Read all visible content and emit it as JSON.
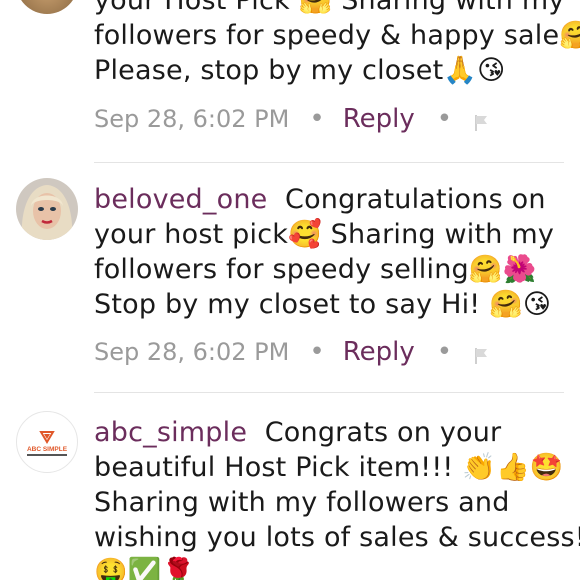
{
  "comments": [
    {
      "username": "",
      "lines": [
        "your Host Pick 🤗 Sharing with my",
        "followers for speedy & happy sale🤗",
        "Please, stop by my closet🙏😘"
      ],
      "timestamp": "Sep 28, 6:02 PM",
      "reply_label": "Reply"
    },
    {
      "username": "beloved_one",
      "lines": [
        "Congratulations on",
        "your host pick🥰 Sharing with my",
        "followers for speedy selling🤗🌺",
        "Stop by my closet to say Hi! 🤗😘"
      ],
      "timestamp": "Sep 28, 6:02 PM",
      "reply_label": "Reply"
    },
    {
      "username": "abc_simple",
      "avatar_text": "ABC SIMPLE",
      "lines": [
        "Congrats on your",
        "beautiful Host Pick item!!! 👏👍🤩",
        "Sharing with my followers and",
        "wishing you lots of sales & success!!",
        "🤑✅🌹"
      ],
      "timestamp": "",
      "reply_label": ""
    }
  ],
  "colors": {
    "username": "#6b2d5c",
    "meta": "#9a9a9a",
    "divider": "#e4e4e4"
  },
  "icons": [
    "flag-icon",
    "avatar-photo",
    "abc-simple-logo"
  ]
}
